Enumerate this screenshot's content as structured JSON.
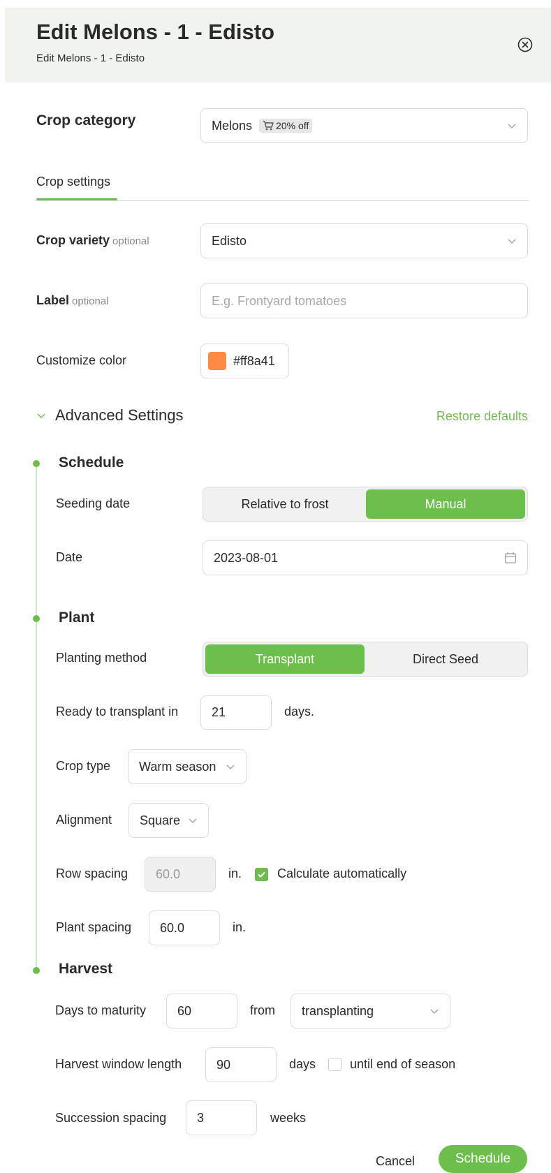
{
  "header": {
    "title": "Edit Melons - 1 - Edisto",
    "subtitle": "Edit Melons - 1 - Edisto"
  },
  "crop_category": {
    "label": "Crop category",
    "value": "Melons",
    "badge": "20% off"
  },
  "tabs": [
    {
      "label": "Crop settings",
      "active": true
    }
  ],
  "crop_variety": {
    "label": "Crop variety",
    "optional": "optional",
    "value": "Edisto"
  },
  "label_field": {
    "label": "Label",
    "optional": "optional",
    "placeholder": "E.g. Frontyard tomatoes"
  },
  "color": {
    "label": "Customize color",
    "value": "#ff8a41"
  },
  "advanced": {
    "title": "Advanced Settings",
    "restore": "Restore defaults"
  },
  "schedule": {
    "title": "Schedule",
    "seeding_label": "Seeding date",
    "options": [
      "Relative to frost",
      "Manual"
    ],
    "active_option": "Manual",
    "date_label": "Date",
    "date_value": "2023-08-01"
  },
  "plant": {
    "title": "Plant",
    "method_label": "Planting method",
    "methods": [
      "Transplant",
      "Direct Seed"
    ],
    "active_method": "Transplant",
    "ready_label": "Ready to transplant in",
    "ready_value": "21",
    "ready_unit": "days.",
    "crop_type_label": "Crop type",
    "crop_type_value": "Warm season",
    "alignment_label": "Alignment",
    "alignment_value": "Square",
    "row_spacing_label": "Row spacing",
    "row_spacing_value": "60.0",
    "row_spacing_unit": "in.",
    "calc_auto_label": "Calculate automatically",
    "calc_auto_checked": true,
    "plant_spacing_label": "Plant spacing",
    "plant_spacing_value": "60.0",
    "plant_spacing_unit": "in."
  },
  "harvest": {
    "title": "Harvest",
    "maturity_label": "Days to maturity",
    "maturity_value": "60",
    "from_label": "from",
    "from_value": "transplanting",
    "window_label": "Harvest window length",
    "window_value": "90",
    "window_unit": "days",
    "end_season_label": "until end of season",
    "end_season_checked": false,
    "succession_label": "Succession spacing",
    "succession_value": "3",
    "succession_unit": "weeks"
  },
  "footer": {
    "cancel": "Cancel",
    "submit": "Schedule"
  },
  "colors": {
    "accent": "#6cbf4b",
    "header_bg": "#f1f3ee",
    "swatch": "#ff8a41"
  }
}
